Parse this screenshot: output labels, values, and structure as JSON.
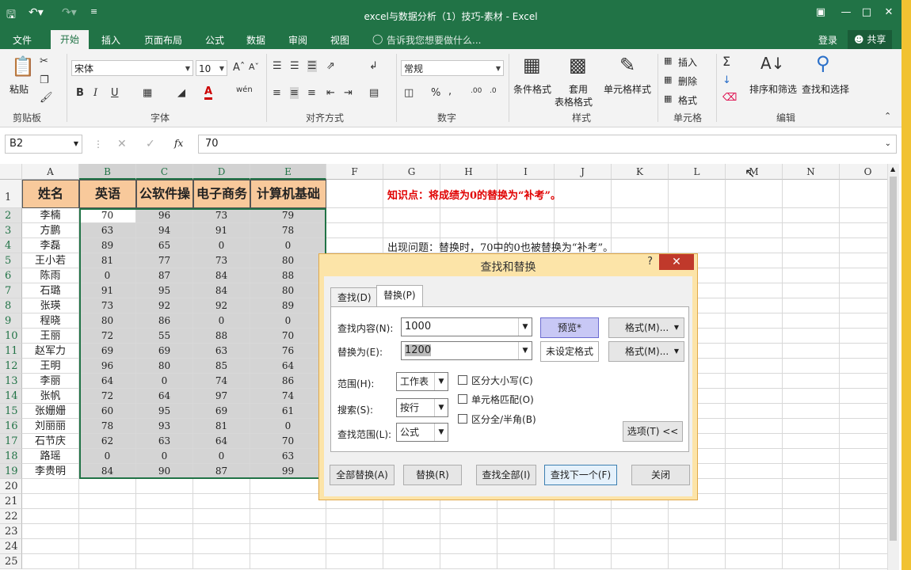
{
  "window": {
    "title": "excel与数据分析（1）技巧-素材 - Excel",
    "colors": {
      "brand": "#217346",
      "dialog_frame": "#fce4a8",
      "header_fill": "#f8c99b",
      "annotation_red": "#e00000",
      "close_red": "#c0392b"
    }
  },
  "tabs": [
    "文件",
    "开始",
    "插入",
    "页面布局",
    "公式",
    "数据",
    "审阅",
    "视图"
  ],
  "tell_me": "告诉我您想要做什么...",
  "account": {
    "login": "登录",
    "share": "共享"
  },
  "ribbon": {
    "clipboard": {
      "paste": "粘贴",
      "label": "剪贴板"
    },
    "font": {
      "name": "宋体",
      "size": "10",
      "label": "字体",
      "bold": "B",
      "italic": "I",
      "underline": "U"
    },
    "alignment": {
      "label": "对齐方式"
    },
    "number": {
      "format": "常规",
      "label": "数字",
      "percent": "%"
    },
    "styles": {
      "cond_format": "条件格式",
      "table_format_1": "套用",
      "table_format_2": "表格格式",
      "cell_style": "单元格样式",
      "label": "样式"
    },
    "cells": {
      "insert": "插入",
      "delete": "删除",
      "format": "格式",
      "label": "单元格"
    },
    "editing": {
      "sort_filter": "排序和筛选",
      "find_select": "查找和选择",
      "label": "编辑"
    }
  },
  "formula_bar": {
    "name_box": "B2",
    "fx": "fx",
    "value": "70"
  },
  "columns": [
    "A",
    "B",
    "C",
    "D",
    "E",
    "F",
    "G",
    "H",
    "I",
    "J",
    "K",
    "L",
    "M",
    "N",
    "O"
  ],
  "rows": [
    "1",
    "2",
    "3",
    "4",
    "5",
    "6",
    "7",
    "8",
    "9",
    "10",
    "11",
    "12",
    "13",
    "14",
    "15",
    "16",
    "17",
    "18",
    "19",
    "20",
    "21",
    "22",
    "23",
    "24",
    "25"
  ],
  "table": {
    "headers": [
      "姓名",
      "英语",
      "公软件操",
      "电子商务",
      "计算机基础"
    ],
    "records": [
      [
        "李楠",
        "70",
        "96",
        "73",
        "79"
      ],
      [
        "方鹏",
        "63",
        "94",
        "91",
        "78"
      ],
      [
        "李磊",
        "89",
        "65",
        "0",
        "0"
      ],
      [
        "王小若",
        "81",
        "77",
        "73",
        "80"
      ],
      [
        "陈雨",
        "0",
        "87",
        "84",
        "88"
      ],
      [
        "石璐",
        "91",
        "95",
        "84",
        "80"
      ],
      [
        "张瑛",
        "73",
        "92",
        "92",
        "89"
      ],
      [
        "程晓",
        "80",
        "86",
        "0",
        "0"
      ],
      [
        "王丽",
        "72",
        "55",
        "88",
        "70"
      ],
      [
        "赵军力",
        "69",
        "69",
        "63",
        "76"
      ],
      [
        "王明",
        "96",
        "80",
        "85",
        "64"
      ],
      [
        "李丽",
        "64",
        "0",
        "74",
        "86"
      ],
      [
        "张帆",
        "72",
        "64",
        "97",
        "74"
      ],
      [
        "张姗姗",
        "60",
        "95",
        "69",
        "61"
      ],
      [
        "刘丽丽",
        "78",
        "93",
        "81",
        "0"
      ],
      [
        "石节庆",
        "62",
        "63",
        "64",
        "70"
      ],
      [
        "路瑶",
        "0",
        "0",
        "0",
        "63"
      ],
      [
        "李贵明",
        "84",
        "90",
        "87",
        "99"
      ]
    ]
  },
  "annotations": {
    "knowledge": "知识点：将成绩为0的替换为“补考”。",
    "problem": "出现问题：替换时，70中的0也被替换为“补考”。"
  },
  "dialog": {
    "title": "查找和替换",
    "help": "?",
    "close": "✕",
    "tab_find": "查找(D)",
    "tab_replace": "替换(P)",
    "find_label": "查找内容(N):",
    "find_value": "1000",
    "preview_btn": "预览*",
    "format_btn_1": "格式(M)...",
    "replace_label": "替换为(E):",
    "replace_value": "1200",
    "no_format": "未设定格式",
    "format_btn_2": "格式(M)...",
    "scope_label": "范围(H):",
    "scope_value": "工作表",
    "search_label": "搜索(S):",
    "search_value": "按行",
    "lookin_label": "查找范围(L):",
    "lookin_value": "公式",
    "match_case": "区分大小写(C)",
    "match_cell": "单元格匹配(O)",
    "match_width": "区分全/半角(B)",
    "options_btn": "选项(T) <<",
    "replace_all": "全部替换(A)",
    "replace": "替换(R)",
    "find_all": "查找全部(I)",
    "find_next": "查找下一个(F)",
    "close_btn": "关闭"
  }
}
